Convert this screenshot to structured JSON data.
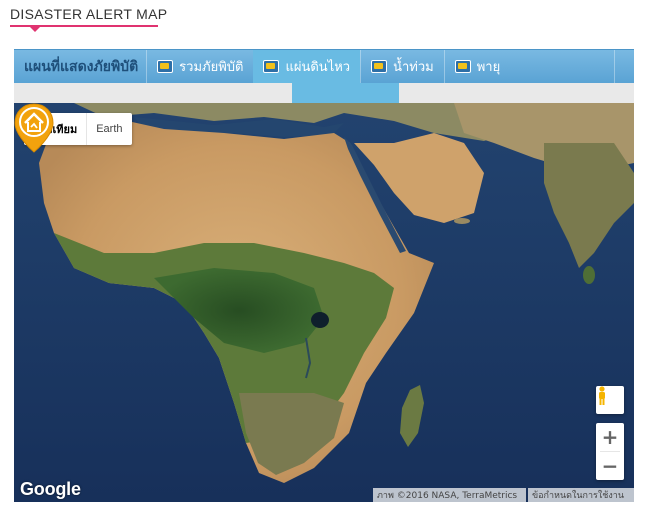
{
  "heading": {
    "title": "DISASTER ALERT MAP"
  },
  "tabs": {
    "title": "แผนที่แสดงภัยพิบัติ",
    "items": [
      {
        "label": "รวมภัยพิบัติ",
        "icon": "map-flag-icon"
      },
      {
        "label": "แผ่นดินไหว",
        "icon": "map-flag-icon",
        "active": true
      },
      {
        "label": "น้ำท่วม",
        "icon": "map-flag-icon"
      },
      {
        "label": "พายุ",
        "icon": "map-flag-icon"
      }
    ]
  },
  "map": {
    "type_buttons": {
      "satellite": "ดาวเทียม",
      "earth": "Earth"
    },
    "zoom": {
      "in": "+",
      "out": "−"
    },
    "logo": "Google",
    "attribution": "ภาพ ©2016 NASA, TerraMetrics",
    "terms": "ข้อกำหนดในการใช้งาน",
    "marker_icon": "earthquake-house-icon",
    "colors": {
      "accent": "#e03370",
      "tab_bar": "#5aa3d4",
      "tab_active": "#69bbe3",
      "marker": "#f2a20d",
      "ocean": "#1d3a64"
    }
  }
}
